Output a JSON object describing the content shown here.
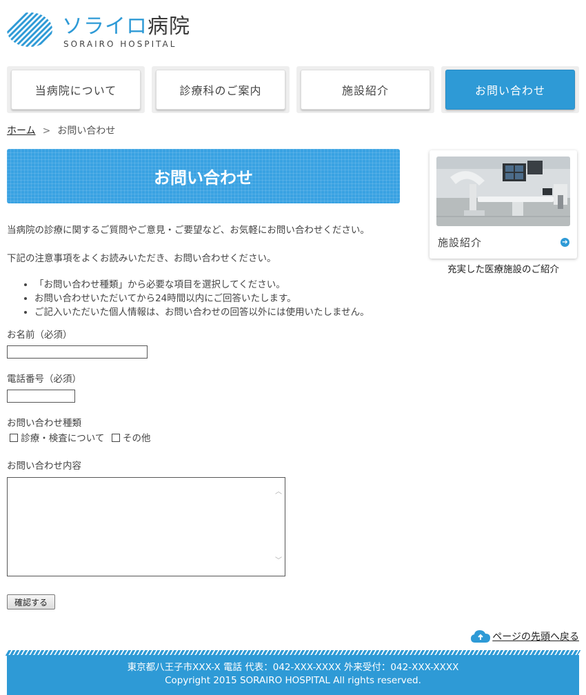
{
  "header": {
    "logo_jp_blue": "ソライロ",
    "logo_jp_dark": "病院",
    "logo_en": "SORAIRO HOSPITAL"
  },
  "nav": {
    "items": [
      {
        "label": "当病院について"
      },
      {
        "label": "診療科のご案内"
      },
      {
        "label": "施設紹介"
      },
      {
        "label": "お問い合わせ"
      }
    ]
  },
  "breadcrumb": {
    "home": "ホーム",
    "separator": ">",
    "current": "お問い合わせ"
  },
  "main": {
    "title": "お問い合わせ",
    "intro1": "当病院の診療に関するご質問やご意見・ご要望など、お気軽にお問い合わせください。",
    "intro2": "下記の注意事項をよくお読みいただき、お問い合わせください。",
    "notes": [
      "「お問い合わせ種類」から必要な項目を選択してください。",
      "お問い合わせいただいてから24時間以内にご回答いたします。",
      "ご記入いただいた個人情報は、お問い合わせの回答以外には使用いたしません。"
    ]
  },
  "form": {
    "name_label": "お名前（必須）",
    "name_value": "",
    "phone_label": "電話番号（必須）",
    "phone_value": "",
    "type_label": "お問い合わせ種類",
    "type_options": [
      "診療・検査について",
      "その他"
    ],
    "content_label": "お問い合わせ内容",
    "content_value": "",
    "submit_label": "確認する"
  },
  "sidebar": {
    "card_title": "施設紹介",
    "card_caption": "充実した医療施設のご紹介"
  },
  "to_top": {
    "label": "ページの先頭へ戻る"
  },
  "footer": {
    "address": "東京都八王子市XXX-X 電話 代表：042-XXX-XXXX 外来受付：042-XXX-XXXX",
    "copyright": "Copyright 2015 SORAIRO HOSPITAL All rights reserved."
  },
  "colors": {
    "brand_blue": "#2e9ad6",
    "text": "#444444"
  }
}
